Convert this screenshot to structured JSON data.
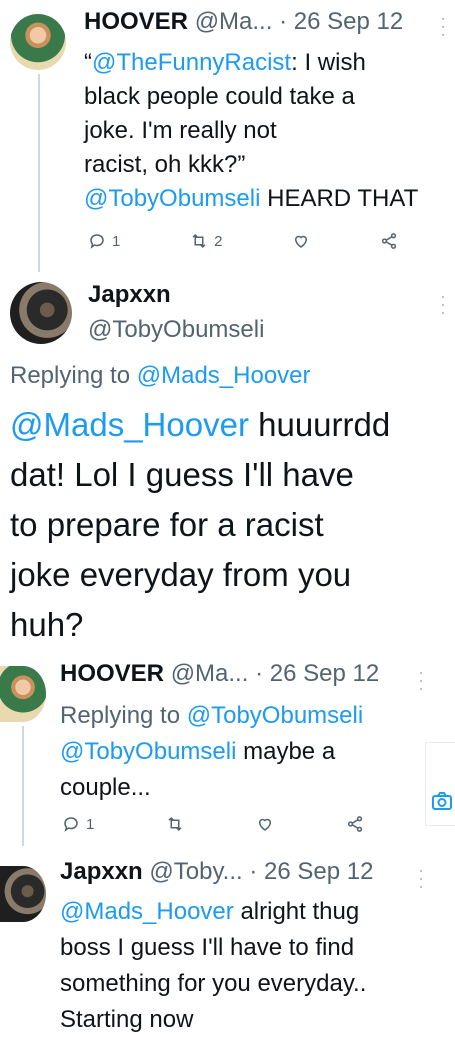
{
  "tweet1": {
    "name": "HOOVER",
    "handle": "@Ma...",
    "date": "· 26 Sep 12",
    "quote_open": "“",
    "quoted_handle": "@TheFunnyRacist",
    "quote_text_1": ": I wish",
    "quote_line_2": "black people could take a",
    "quote_line_3": "joke. I'm really not",
    "quote_line_4": "racist, oh kkk?”",
    "mention": "@TobyObumseli",
    "tail": "HEARD THAT",
    "reply_count": "1",
    "retweet_count": "2"
  },
  "tweet2": {
    "name": "Japxxn",
    "handle": "@TobyObumseli",
    "replying_prefix": "Replying to",
    "replying_to": "@Mads_Hoover",
    "mention": "@Mads_Hoover",
    "line1_rest": "huuurrdd",
    "line2": "dat! Lol I guess I'll have",
    "line3": "to prepare for a racist",
    "line4": "joke everyday from you",
    "line5": "huh?"
  },
  "tweet3": {
    "name": "HOOVER",
    "handle": "@Ma...",
    "date": "· 26 Sep 12",
    "replying_prefix": "Replying to",
    "replying_to": "@TobyObumseli",
    "mention": "@TobyObumseli",
    "line1_rest": "maybe a",
    "line2": "couple...",
    "reply_count": "1"
  },
  "tweet4": {
    "name": "Japxxn",
    "handle": "@Toby...",
    "date": "· 26 Sep 12",
    "mention": "@Mads_Hoover",
    "line1_rest": "alright thug",
    "line2": "boss I guess I'll have to find",
    "line3": "something for you everyday..",
    "line4": "Starting now"
  },
  "icons": {
    "reply": "reply-icon",
    "retweet": "retweet-icon",
    "like": "heart-icon",
    "share": "share-icon",
    "more": "more-vertical-icon",
    "camera": "camera-icon"
  },
  "colors": {
    "link": "#1d9bf0",
    "muted": "#536471",
    "text": "#0f1419"
  }
}
